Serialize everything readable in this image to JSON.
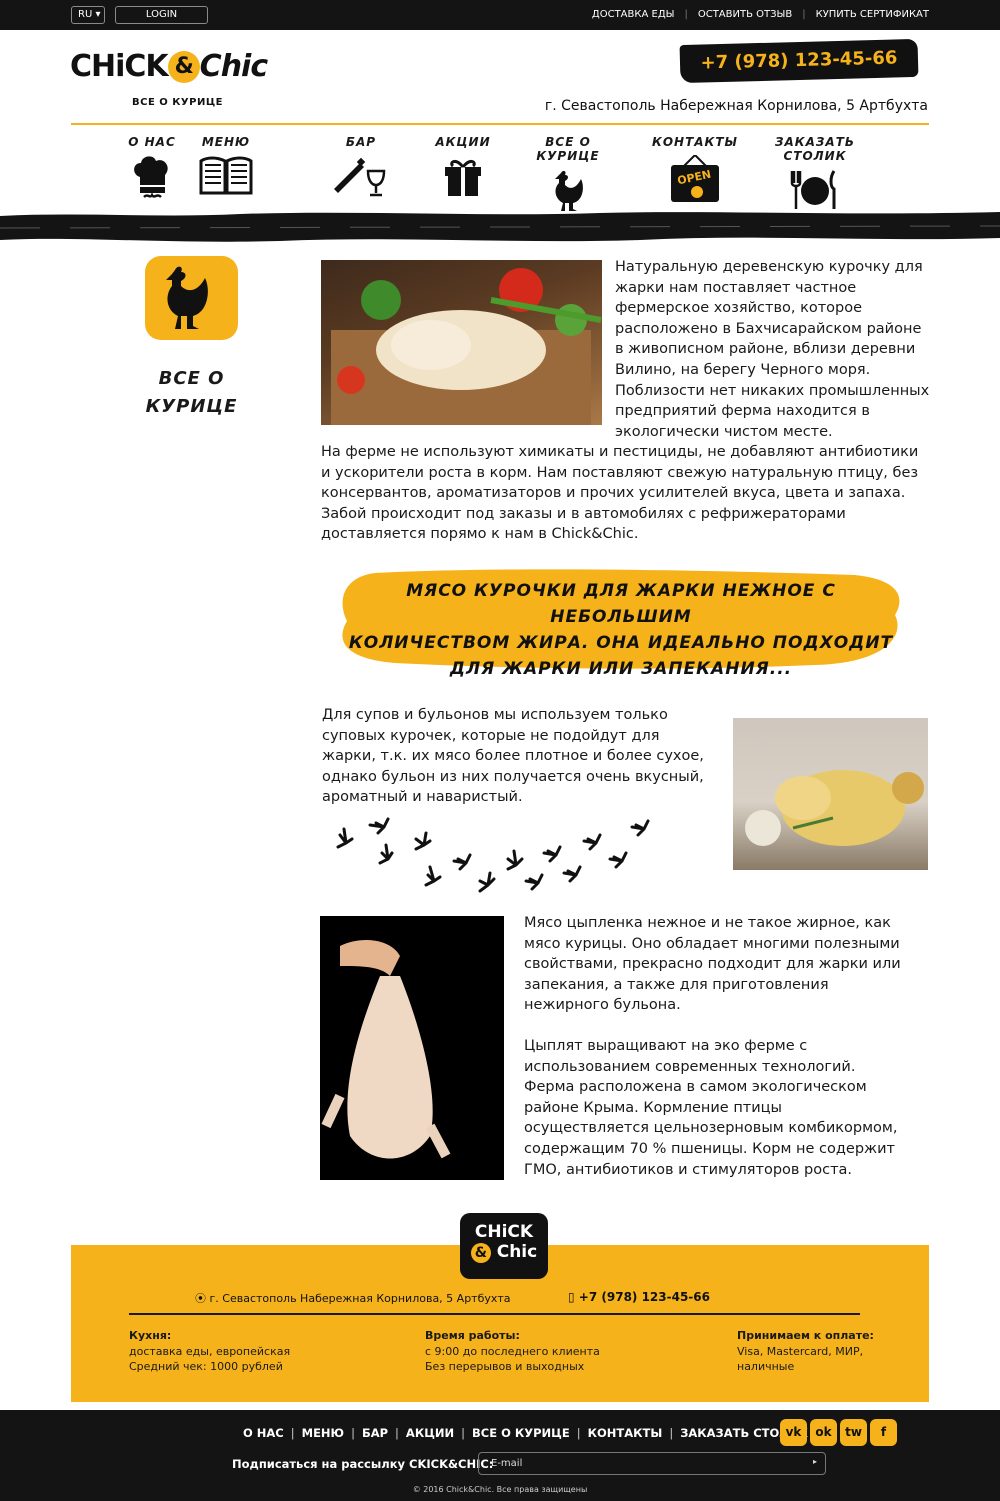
{
  "topbar": {
    "lang": "RU ▾",
    "login": "LOGIN",
    "links": [
      "ДОСТАВКА ЕДЫ",
      "ОСТАВИТЬ ОТЗЫВ",
      "КУПИТЬ СЕРТИФИКАТ"
    ],
    "sep": "|"
  },
  "header": {
    "logo_chick": "CHiCK",
    "logo_amp": "&",
    "logo_chic": "Chic",
    "tagline": "ВСЕ О КУРИЦЕ",
    "phone": "+7 (978) 123-45-66",
    "address": "г. Севастополь Набережная Корнилова, 5 Артбухта"
  },
  "nav": [
    {
      "label": "О НАС",
      "icon": "chef-hat-icon"
    },
    {
      "label": "МЕНЮ",
      "icon": "book-icon"
    },
    {
      "label": "БАР",
      "icon": "wine-icon"
    },
    {
      "label": "АКЦИИ",
      "icon": "gift-icon"
    },
    {
      "label": "ВСЕ О КУРИЦЕ",
      "icon": "chicken-icon"
    },
    {
      "label": "КОНТАКТЫ",
      "icon": "open-sign-icon"
    },
    {
      "label": "ЗАКАЗАТЬ СТОЛИК",
      "icon": "plate-icon"
    }
  ],
  "open_sign": "OPEN",
  "side": {
    "title": "ВСЕ О КУРИЦЕ",
    "icon": "chicken-icon"
  },
  "content": {
    "para1a": "Натуральную деревенскую курочку для жарки нам поставляет частное фермерское хозяйство, которое расположено в Бахчисарайском районе в живописном районе, вблизи деревни Вилино, на берегу Черного моря. Поблизости нет никаких промышленных предприятий ферма находится в экологически чистом месте.",
    "para1b": "На ферме не используют химикаты и пестициды, не добавляют антибиотики и ускорители роста в корм. Нам поставляют свежую натуральную птицу, без консервантов, ароматизаторов и прочих усилителей вкуса, цвета и запаха. Забой происходит под заказы и в автомобилях с рефрижераторами доставляется порямо к нам в Chick&Chic.",
    "quote_line1": "МЯСО КУРОЧКИ ДЛЯ ЖАРКИ НЕЖНОЕ С НЕБОЛЬШИМ",
    "quote_line2": "КОЛИЧЕСТВОМ ЖИРА. ОНА ИДЕАЛЬНО ПОДХОДИТ",
    "quote_line3": "ДЛЯ ЖАРКИ ИЛИ ЗАПЕКАНИЯ...",
    "para2": "Для супов и бульонов мы используем только суповых курочек, которые не подойдут для жарки, т.к. их мясо более плотное и более сухое, однако бульон из них получается очень вкусный, ароматный и наваристый.",
    "para3": "Мясо цыпленка нежное и не такое жирное, как мясо курицы. Оно обладает многими полезными свойствами, прекрасно подходит для жарки или запекания, а также для приготовления нежирного бульона.",
    "para4": "Цыплят выращивают на эко ферме с использованием современных технологий. Ферма расположена в самом экологическом районе Крыма. Кормление птицы осуществляется цельнозерновым комбикормом, содержащим 70 % пшеницы. Корм не содержит ГМО, антибиотиков и стимуляторов роста."
  },
  "footer": {
    "logo_top": "CHiCK",
    "logo_amp": "&",
    "logo_bottom": "Chic",
    "address": "г. Севастополь Набережная Корнилова, 5 Артбухта",
    "phone": "+7 (978) 123-45-66",
    "kitchen_title": "Кухня:",
    "kitchen_line1": "доставка еды, европейская",
    "kitchen_line2": "Средний чек: 1000 рублей",
    "hours_title": "Время работы:",
    "hours_line1": "с 9:00 до последнего клиента",
    "hours_line2": "Без перерывов и выходных",
    "pay_title": "Принимаем к оплате:",
    "pay_line1": "Visa, Mastercard, МИР,",
    "pay_line2": "наличные"
  },
  "bottom": {
    "nav": [
      "О НАС",
      "МЕНЮ",
      "БАР",
      "АКЦИИ",
      "ВСЕ О КУРИЦЕ",
      "КОНТАКТЫ",
      "ЗАКАЗАТЬ СТОЛИК"
    ],
    "sep": "|",
    "social": [
      {
        "label": "vk",
        "icon": "vk-icon"
      },
      {
        "label": "ok",
        "icon": "odnoklassniki-icon"
      },
      {
        "label": "tw",
        "icon": "twitter-icon"
      },
      {
        "label": "f",
        "icon": "facebook-icon"
      }
    ],
    "subscribe_label": "Подписаться на рассылку CKICK&CHIC:",
    "email_placeholder": "E-mail",
    "email_btn": "▸",
    "copyright": "© 2016 Chick&Chic. Все права защищены"
  },
  "colors": {
    "accent": "#f6b21b",
    "dark": "#141414"
  }
}
